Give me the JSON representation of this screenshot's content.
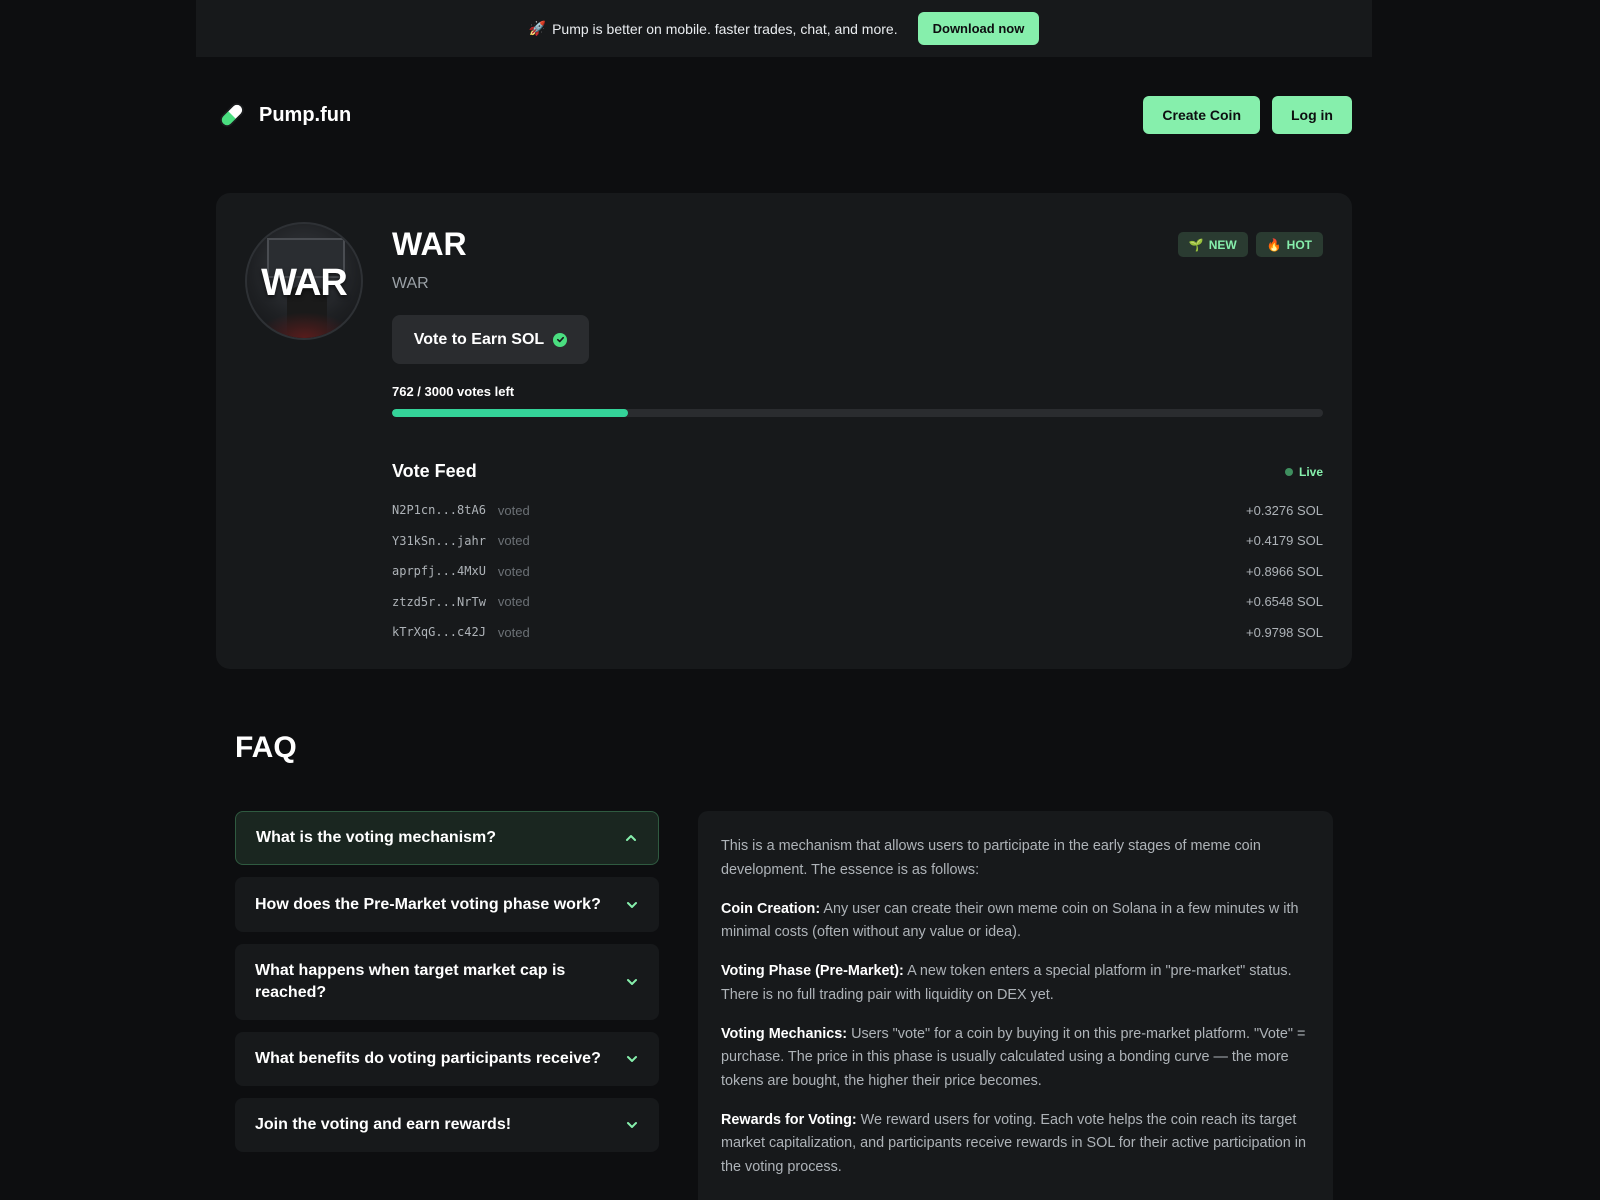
{
  "banner": {
    "message": "Pump is better on mobile. faster trades, chat, and more.",
    "icon": "rocket-icon",
    "button": "Download now"
  },
  "header": {
    "brand": "Pump.fun",
    "logo_icon": "pill-icon",
    "create_button": "Create Coin",
    "login_button": "Log in"
  },
  "coin": {
    "name": "WAR",
    "ticker": "WAR",
    "avatar_text": "WAR",
    "badges": [
      {
        "emoji": "🌱",
        "label": "NEW"
      },
      {
        "emoji": "🔥",
        "label": "HOT"
      }
    ],
    "vote_button": "Vote to Earn SOL",
    "votes_left_text": "762 / 3000 votes left",
    "votes_progress_fraction": 0.254,
    "accent_color": "#34d399"
  },
  "feed": {
    "title": "Vote Feed",
    "live_label": "Live",
    "rows": [
      {
        "address": "N2P1cn...8tA6",
        "action": "voted",
        "amount": "+0.3276 SOL"
      },
      {
        "address": "Y31kSn...jahr",
        "action": "voted",
        "amount": "+0.4179 SOL"
      },
      {
        "address": "aprpfj...4MxU",
        "action": "voted",
        "amount": "+0.8966 SOL"
      },
      {
        "address": "ztzd5r...NrTw",
        "action": "voted",
        "amount": "+0.6548 SOL"
      },
      {
        "address": "kTrXqG...c42J",
        "action": "voted",
        "amount": "+0.9798 SOL"
      }
    ]
  },
  "faq": {
    "title": "FAQ",
    "questions": [
      {
        "label": "What is the voting mechanism?",
        "expanded": true
      },
      {
        "label": "How does the Pre-Market voting phase work?",
        "expanded": false
      },
      {
        "label": "What happens when target market cap is reached?",
        "expanded": false
      },
      {
        "label": "What benefits do voting participants receive?",
        "expanded": false
      },
      {
        "label": "Join the voting and earn rewards!",
        "expanded": false
      }
    ],
    "answer": {
      "intro": "This is a mechanism that allows users to participate in the early stages of meme coin development. The essence is as follows:",
      "points": [
        {
          "term": "Coin Creation:",
          "text": "Any user can create their own meme coin on Solana in a few minutes w ith minimal costs (often without any value or idea)."
        },
        {
          "term": "Voting Phase (Pre-Market):",
          "text": "A new token enters a special platform in \"pre-market\" status. There is no full trading pair with liquidity on DEX yet."
        },
        {
          "term": "Voting Mechanics:",
          "text": "Users \"vote\" for a coin by buying it on this pre-market platform. \"Vote\" = purchase. The price in this phase is usually calculated using a bonding curve — the more tokens are bought, the higher their price becomes."
        },
        {
          "term": "Rewards for Voting:",
          "text": "We reward users for voting. Each vote helps the coin reach its target market capitalization, and participants receive rewards in SOL for their active participation in the voting process."
        }
      ]
    }
  }
}
